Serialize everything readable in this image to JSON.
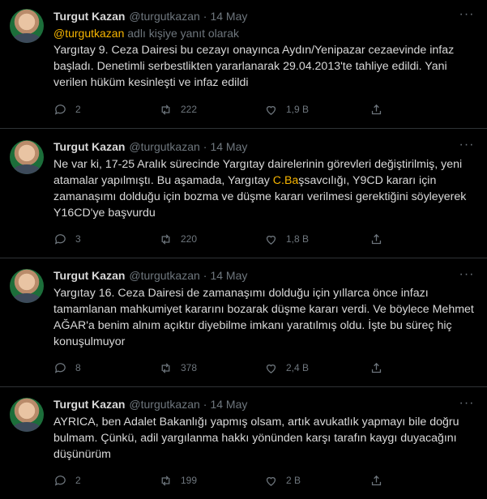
{
  "colors": {
    "background": "#000000",
    "accent": "#f7b500",
    "muted": "#6e767d",
    "text": "#d9d9d9"
  },
  "tweets": [
    {
      "name": "Turgut Kazan",
      "handle": "@turgutkazan",
      "sep": "·",
      "date": "14 May",
      "more": "···",
      "reply_mention": "@turgutkazan",
      "reply_suffix": "adlı kişiye yanıt olarak",
      "text": "Yargıtay 9. Ceza Dairesi bu cezayı onayınca Aydın/Yenipazar cezaevinde infaz başladı. Denetimli serbestlikten yararlanarak 29.04.2013'te tahliye edildi. Yani verilen hüküm kesinleşti ve infaz edildi",
      "replies": "2",
      "retweets": "222",
      "likes": "1,9 B"
    },
    {
      "name": "Turgut Kazan",
      "handle": "@turgutkazan",
      "sep": "·",
      "date": "14 May",
      "more": "···",
      "text_a": "Ne var ki, 17-25 Aralık sürecinde Yargıtay dairelerinin görevleri değiştirilmiş, yeni atamalar yapılmıştı. Bu aşamada, Yargıtay ",
      "text_hl": "C.Ba",
      "text_b": "şsavcılığı, Y9CD kararı için zamanaşımı dolduğu için bozma ve düşme kararı verilmesi gerektiğini söyleyerek Y16CD'ye başvurdu",
      "replies": "3",
      "retweets": "220",
      "likes": "1,8 B"
    },
    {
      "name": "Turgut Kazan",
      "handle": "@turgutkazan",
      "sep": "·",
      "date": "14 May",
      "more": "···",
      "text": "Yargıtay 16. Ceza Dairesi de zamanaşımı dolduğu için yıllarca önce infazı tamamlanan mahkumiyet kararını bozarak düşme kararı verdi. Ve böylece Mehmet AĞAR'a benim alnım açıktır diyebilme imkanı yaratılmış oldu. İşte bu süreç hiç konuşulmuyor",
      "replies": "8",
      "retweets": "378",
      "likes": "2,4 B"
    },
    {
      "name": "Turgut Kazan",
      "handle": "@turgutkazan",
      "sep": "·",
      "date": "14 May",
      "more": "···",
      "text": "AYRICA, ben Adalet Bakanlığı yapmış olsam, artık avukatlık yapmayı bile doğru bulmam. Çünkü, adil yargılanma hakkı yönünden karşı tarafın kaygı duyacağını düşünürüm",
      "replies": "2",
      "retweets": "199",
      "likes": "2 B"
    }
  ]
}
